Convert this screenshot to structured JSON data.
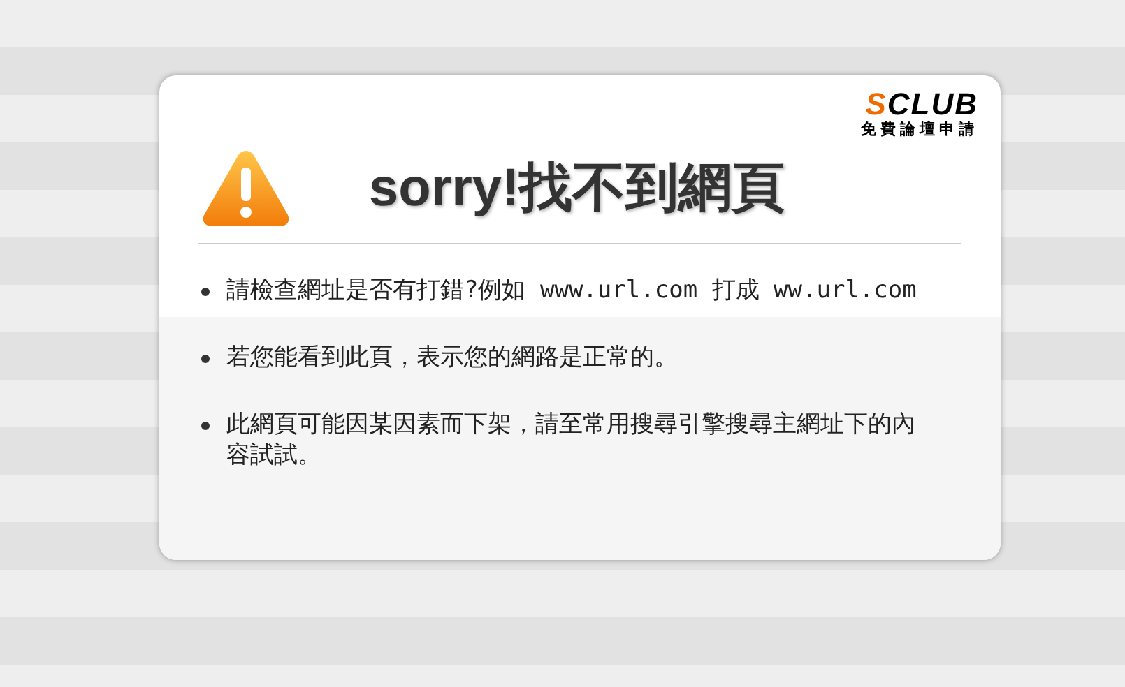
{
  "logo": {
    "brand": "SCLUB",
    "tagline": "免費論壇申請"
  },
  "heading": "sorry!找不到網頁",
  "tips": [
    {
      "text": "請檢查網址是否有打錯?例如 www.url.com 打成 ww.url.com"
    },
    {
      "text": "若您能看到此頁，表示您的網路是正常的。"
    },
    {
      "text": "此網頁可能因某因素而下架，請至常用搜尋引擎搜尋主網址下的內容試試。"
    }
  ]
}
